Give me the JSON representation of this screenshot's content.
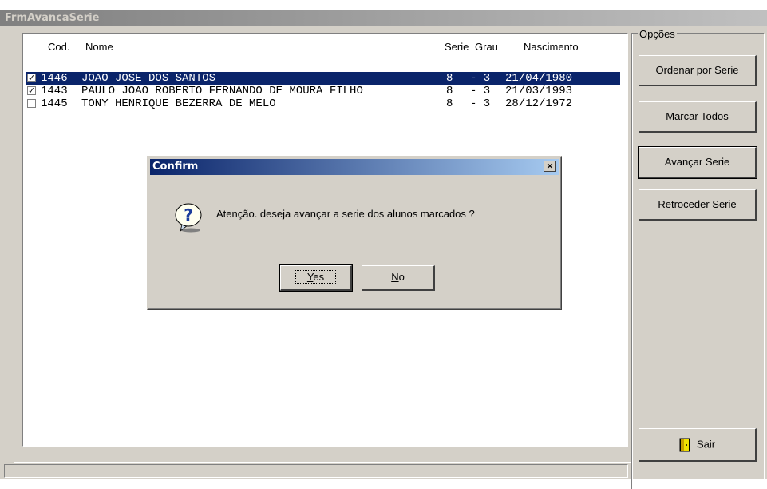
{
  "window": {
    "title": "FrmAvancaSerie"
  },
  "list": {
    "headers": {
      "cod": "Cod.",
      "nome": "Nome",
      "serie": "Serie",
      "grau": "Grau",
      "nascimento": "Nascimento"
    },
    "rows": [
      {
        "checked": true,
        "selected": true,
        "cod": "1446",
        "nome": "JOAO JOSE DOS SANTOS",
        "serie": "8",
        "grau": "- 3",
        "nascimento": "21/04/1980"
      },
      {
        "checked": true,
        "selected": false,
        "cod": "1443",
        "nome": "PAULO JOAO ROBERTO FERNANDO DE MOURA FILHO",
        "serie": "8",
        "grau": "- 3",
        "nascimento": "21/03/1993"
      },
      {
        "checked": false,
        "selected": false,
        "cod": "1445",
        "nome": "TONY HENRIQUE BEZERRA DE MELO",
        "serie": "8",
        "grau": "- 3",
        "nascimento": "28/12/1972"
      }
    ]
  },
  "options": {
    "legend": "Opções",
    "ordenar": "Ordenar por Serie",
    "marcar": "Marcar Todos",
    "avancar": "Avançar Serie",
    "retroceder": "Retroceder Serie",
    "sair": "Sair"
  },
  "dialog": {
    "title": "Confirm",
    "message": "Atenção. deseja avançar a serie dos alunos marcados ?",
    "yes_underlined": "Y",
    "yes_rest": "es",
    "no_underlined": "N",
    "no_rest": "o",
    "icon": "question-icon",
    "close": "×"
  },
  "colors": {
    "selection": "#0a246a",
    "face": "#d4d0c8",
    "title_inactive": "#808080"
  }
}
